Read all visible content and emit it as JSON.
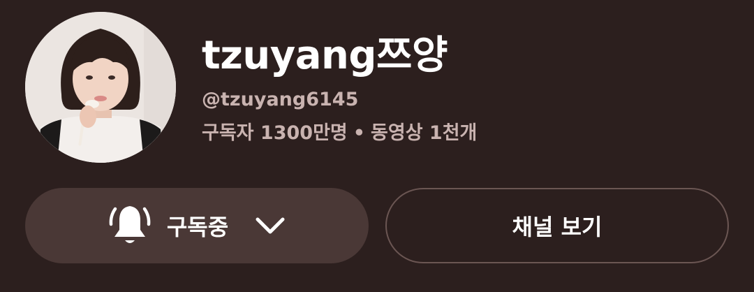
{
  "channel": {
    "name": "tzuyang쯔양",
    "handle": "@tzuyang6145",
    "subscribers": "구독자 1300만명",
    "separator": "•",
    "videos": "동영상 1천개"
  },
  "buttons": {
    "subscribe_label": "구독중",
    "view_channel_label": "채널 보기"
  },
  "icons": {
    "bell": "bell-ringing-icon",
    "dropdown": "chevron-down-icon"
  },
  "colors": {
    "background": "#2c1f1e",
    "subscribe_button": "#4a3836",
    "text_primary": "#ffffff",
    "text_secondary": "#c9b3b0"
  }
}
